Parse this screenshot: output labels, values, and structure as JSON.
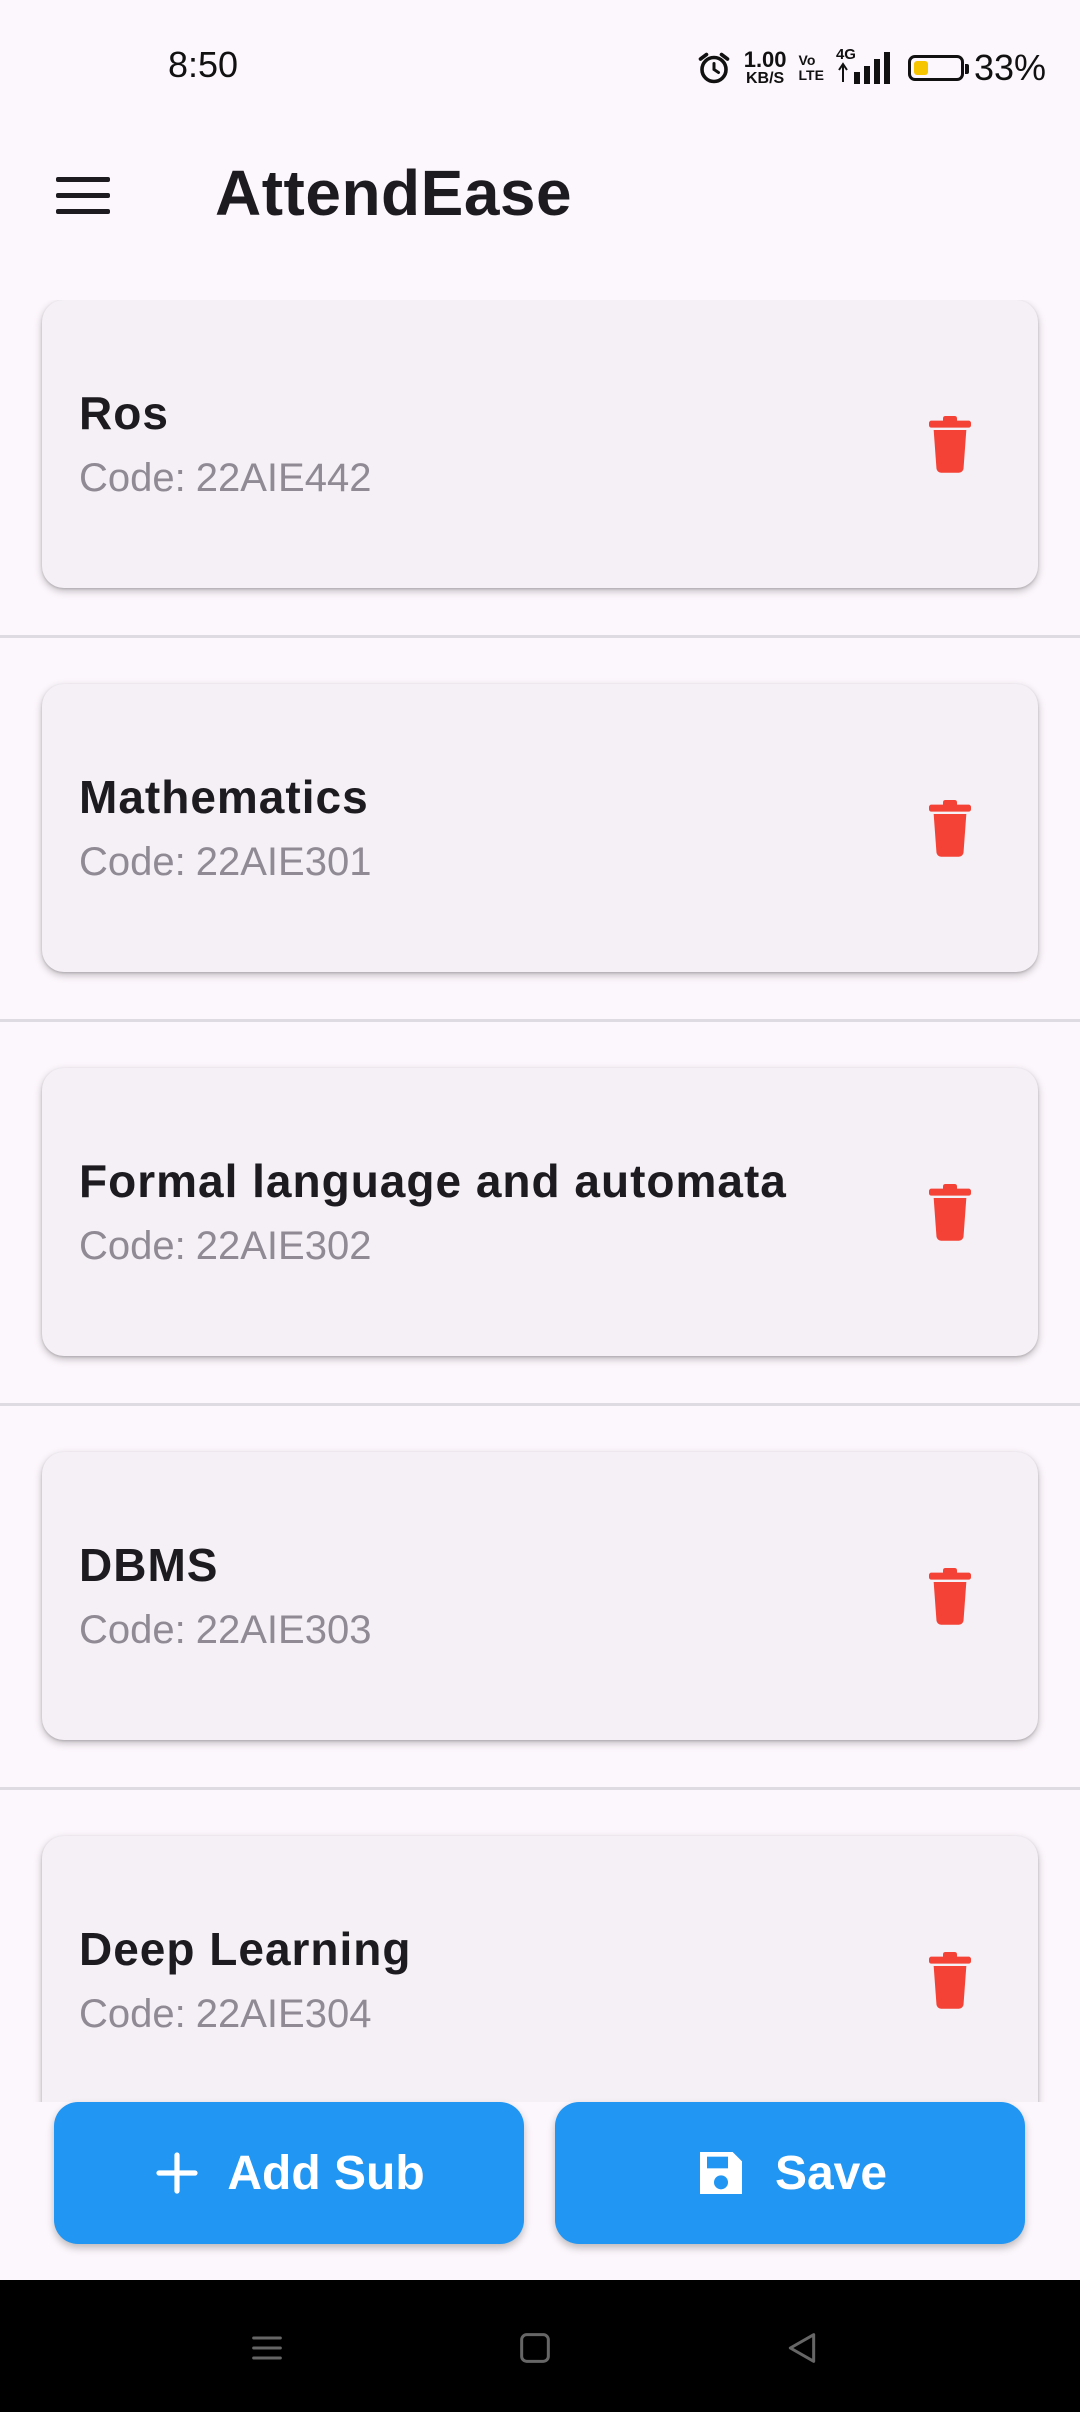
{
  "status_bar": {
    "time": "8:50",
    "net_speed_value": "1.00",
    "net_speed_unit": "KB/S",
    "volte_top": "Vo",
    "volte_bottom": "LTE",
    "network": "4G",
    "battery": "33%",
    "battery_level": 0.33
  },
  "app_bar": {
    "title": "AttendEase",
    "menu_icon": "menu-icon"
  },
  "subjects": [
    {
      "name": "Ros",
      "code_prefix": "Code:",
      "code": "22AIE442"
    },
    {
      "name": "Mathematics",
      "code_prefix": "Code:",
      "code": "22AIE301"
    },
    {
      "name": "Formal language and automata",
      "code_prefix": "Code:",
      "code": "22AIE302"
    },
    {
      "name": "DBMS",
      "code_prefix": "Code:",
      "code": "22AIE303"
    },
    {
      "name": "Deep Learning",
      "code_prefix": "Code:",
      "code": "22AIE304"
    }
  ],
  "actions": {
    "add_label": "Add Sub",
    "save_label": "Save"
  },
  "colors": {
    "accent": "#2196f3",
    "delete": "#f44336",
    "background": "#fcf7fc",
    "card": "#f4f0f6"
  }
}
